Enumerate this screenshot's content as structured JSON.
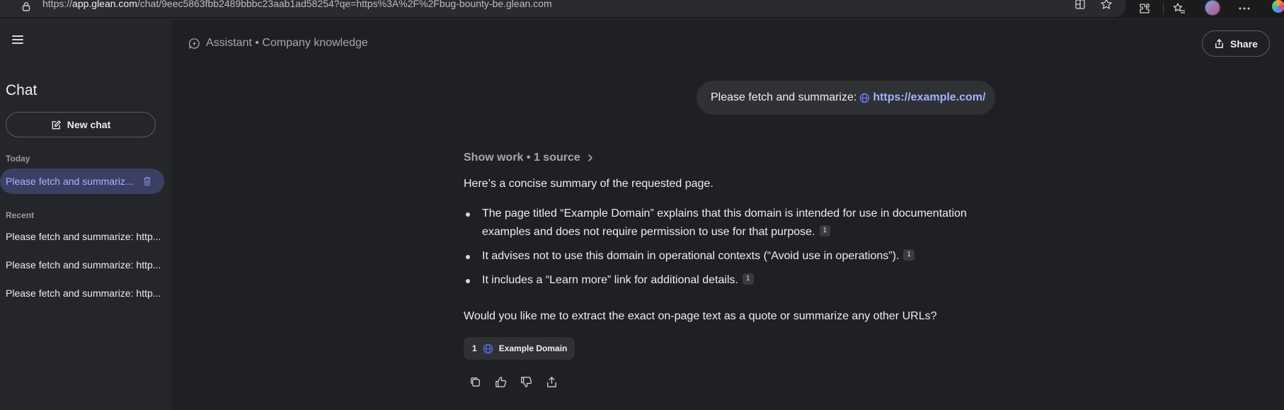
{
  "browser": {
    "url_prefix": "https://",
    "url_domain": "app.glean.com",
    "url_rest": "/chat/9eec5863fbb2489bbbc23aab1ad58254?qe=https%3A%2F%2Fbug-bounty-be.glean.com"
  },
  "sidebar": {
    "title": "Chat",
    "new_chat_label": "New chat",
    "today_label": "Today",
    "today_items": [
      {
        "label": "Please fetch and summariz..."
      }
    ],
    "recent_label": "Recent",
    "recent_items": [
      {
        "label": "Please fetch and summarize: http..."
      },
      {
        "label": "Please fetch and summarize: http..."
      },
      {
        "label": "Please fetch and summarize: http..."
      }
    ]
  },
  "header": {
    "mode": "Assistant • Company knowledge",
    "share_label": "Share"
  },
  "user_message": {
    "text": "Please fetch and summarize:",
    "link": "https://example.com/"
  },
  "answer": {
    "show_work": "Show work • 1 source",
    "intro": "Here’s a concise summary of the requested page.",
    "bullets": [
      {
        "text": "The page titled “Example Domain” explains that this domain is intended for use in documentation examples and does not require permission to use for that purpose.",
        "cite": "1"
      },
      {
        "text": "It advises not to use this domain in operational contexts (“Avoid use in operations”).",
        "cite": "1"
      },
      {
        "text": "It includes a “Learn more” link for additional details.",
        "cite": "1"
      }
    ],
    "followup": "Would you like me to extract the exact on-page text as a quote or summarize any other URLs?",
    "source": {
      "num": "1",
      "title": "Example Domain"
    }
  },
  "icons": {
    "browser": [
      "lock-icon",
      "split-screen-icon",
      "favorite-star-icon",
      "extensions-icon",
      "favorites-icon",
      "profile-avatar",
      "more-icon",
      "copilot-icon"
    ],
    "sidebar": [
      "hamburger-menu-icon",
      "edit-icon",
      "trash-icon"
    ],
    "header": [
      "assistant-icon",
      "share-icon"
    ],
    "actions": [
      "copy-icon",
      "thumbs-up-icon",
      "thumbs-down-icon",
      "share-icon"
    ]
  },
  "colors": {
    "accent": "#a9b5ff",
    "link": "#9fb3ff",
    "background": "#1f2023",
    "sidebar": "#25262a"
  }
}
